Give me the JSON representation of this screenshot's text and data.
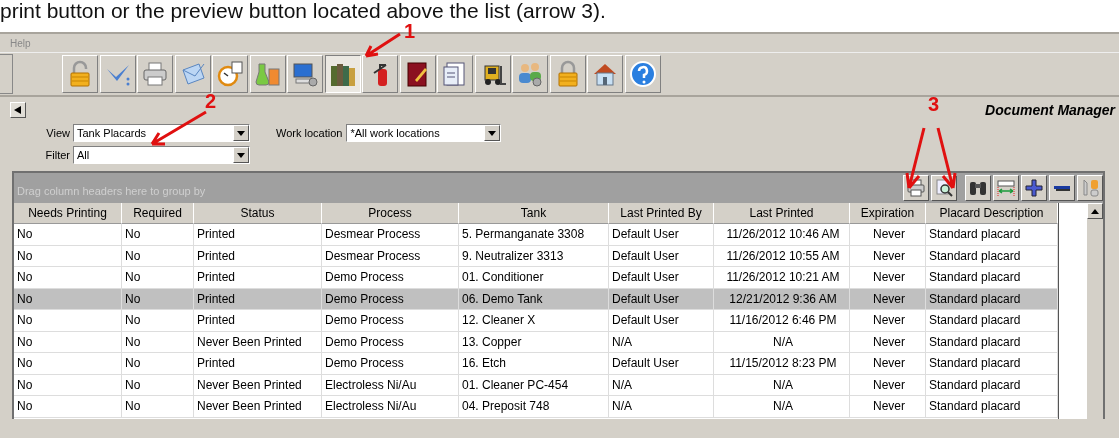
{
  "caption": "print button or the preview button located above the list (arrow 3).",
  "menu": [
    "Help"
  ],
  "toolbar": [
    {
      "selected": false
    },
    {
      "selected": false
    },
    {
      "selected": false
    },
    {
      "selected": false
    },
    {
      "selected": false
    },
    {
      "selected": false
    },
    {
      "selected": false
    },
    {
      "selected": true
    },
    {
      "selected": false
    },
    {
      "selected": false
    },
    {
      "selected": false
    },
    {
      "selected": false
    },
    {
      "selected": false
    },
    {
      "selected": false
    },
    {
      "selected": false
    },
    {
      "selected": false
    }
  ],
  "panel": {
    "title": "Document Manager",
    "view": {
      "label": "View",
      "value": "Tank Placards"
    },
    "work_location": {
      "label": "Work location",
      "value": "*All work locations"
    },
    "filter": {
      "label": "Filter",
      "value": "All"
    }
  },
  "grid": {
    "group_hint": "Drag column headers here to group by",
    "columns": [
      {
        "label": "Needs Printing"
      },
      {
        "label": "Required"
      },
      {
        "label": "Status"
      },
      {
        "label": "Process"
      },
      {
        "label": "Tank"
      },
      {
        "label": "Last Printed By"
      },
      {
        "label": "Last Printed"
      },
      {
        "label": "Expiration"
      },
      {
        "label": "Placard Description"
      }
    ],
    "rows": [
      {
        "selected": false,
        "cells": [
          "No",
          "No",
          "Printed",
          "Desmear Process",
          "5. Permanganate 3308",
          "Default User",
          "11/26/2012 10:46 AM",
          "Never",
          "Standard placard"
        ]
      },
      {
        "selected": false,
        "cells": [
          "No",
          "No",
          "Printed",
          "Desmear Process",
          "9. Neutralizer 3313",
          "Default User",
          "11/26/2012 10:55 AM",
          "Never",
          "Standard placard"
        ]
      },
      {
        "selected": false,
        "cells": [
          "No",
          "No",
          "Printed",
          "Demo Process",
          "01. Conditioner",
          "Default User",
          "11/26/2012 10:21 AM",
          "Never",
          "Standard placard"
        ]
      },
      {
        "selected": true,
        "cells": [
          "No",
          "No",
          "Printed",
          "Demo Process",
          "06. Demo Tank",
          "Default User",
          "12/21/2012 9:36 AM",
          "Never",
          "Standard placard"
        ]
      },
      {
        "selected": false,
        "cells": [
          "No",
          "No",
          "Printed",
          "Demo Process",
          "12. Cleaner X",
          "Default User",
          "11/16/2012 6:46 PM",
          "Never",
          "Standard placard"
        ]
      },
      {
        "selected": false,
        "cells": [
          "No",
          "No",
          "Never Been Printed",
          "Demo Process",
          "13. Copper",
          "N/A",
          "N/A",
          "Never",
          "Standard placard"
        ]
      },
      {
        "selected": false,
        "cells": [
          "No",
          "No",
          "Printed",
          "Demo Process",
          "16. Etch",
          "Default User",
          "11/15/2012 8:23 PM",
          "Never",
          "Standard placard"
        ]
      },
      {
        "selected": false,
        "cells": [
          "No",
          "No",
          "Never Been Printed",
          "Electroless Ni/Au",
          "01. Cleaner PC-454",
          "N/A",
          "N/A",
          "Never",
          "Standard placard"
        ]
      },
      {
        "selected": false,
        "cells": [
          "No",
          "No",
          "Never Been Printed",
          "Electroless Ni/Au",
          "04. Preposit 748",
          "N/A",
          "N/A",
          "Never",
          "Standard placard"
        ]
      }
    ]
  },
  "annotations": [
    {
      "label": "1"
    },
    {
      "label": "2"
    },
    {
      "label": "3"
    }
  ]
}
